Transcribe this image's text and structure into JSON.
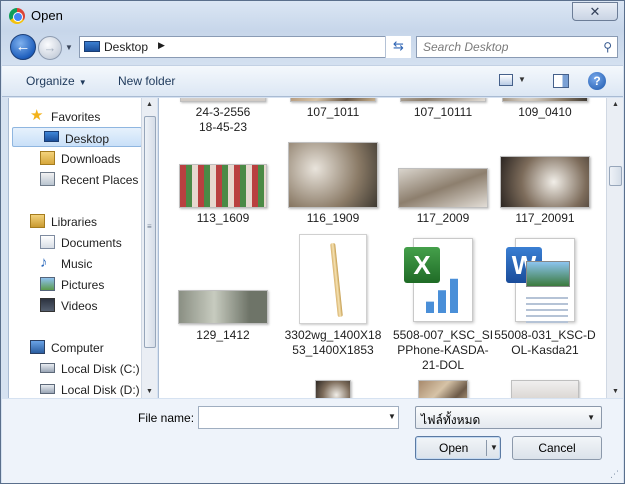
{
  "window": {
    "title": "Open",
    "close_glyph": "✕"
  },
  "nav": {
    "back_glyph": "←",
    "forward_glyph": "→",
    "address_crumb": "Desktop",
    "search_placeholder": "Search Desktop"
  },
  "toolbar": {
    "organize_label": "Organize",
    "new_folder_label": "New folder",
    "help_glyph": "?"
  },
  "sidebar": {
    "favorites": "Favorites",
    "favorites_items": [
      "Desktop",
      "Downloads",
      "Recent Places"
    ],
    "libraries": "Libraries",
    "libraries_items": [
      "Documents",
      "Music",
      "Pictures",
      "Videos"
    ],
    "computer": "Computer",
    "computer_items": [
      "Local Disk (C:)",
      "Local Disk (D:)"
    ]
  },
  "files": [
    {
      "name": "24-3-2556\n18-45-23"
    },
    {
      "name": "107_1011"
    },
    {
      "name": "107_10111"
    },
    {
      "name": "109_0410"
    },
    {
      "name": "113_1609"
    },
    {
      "name": "116_1909"
    },
    {
      "name": "117_2009"
    },
    {
      "name": "117_20091"
    },
    {
      "name": "129_1412"
    },
    {
      "name": "3302wg_1400X18\n53_1400X1853"
    },
    {
      "name": "5508-007_KSC_SI\nPPhone-KASDA-\n21-DOL"
    },
    {
      "name": "55008-031_KSC-D\nOL-Kasda21"
    }
  ],
  "bottom": {
    "file_name_label": "File name:",
    "file_name_value": "",
    "file_type_value": "ไฟล์ทั้งหมด",
    "open_label": "Open",
    "cancel_label": "Cancel"
  },
  "colors": {
    "selection": "#cce4f7",
    "window_frame": "#c7d6ea",
    "accent": "#1f5fbd"
  }
}
